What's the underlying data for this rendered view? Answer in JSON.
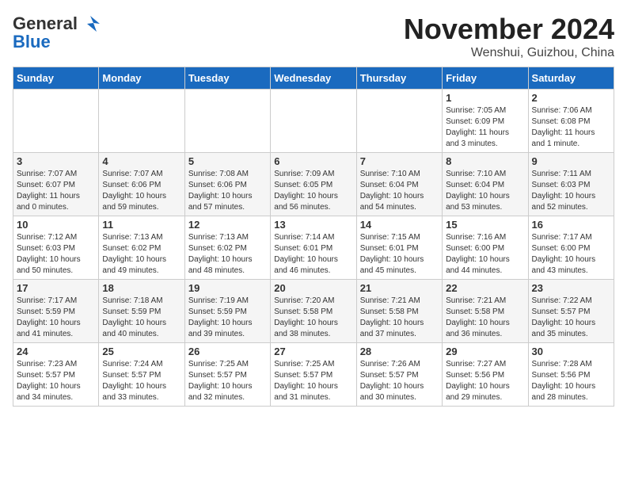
{
  "header": {
    "logo_line1": "General",
    "logo_line2": "Blue",
    "month_title": "November 2024",
    "location": "Wenshui, Guizhou, China"
  },
  "weekdays": [
    "Sunday",
    "Monday",
    "Tuesday",
    "Wednesday",
    "Thursday",
    "Friday",
    "Saturday"
  ],
  "weeks": [
    [
      {
        "day": "",
        "info": ""
      },
      {
        "day": "",
        "info": ""
      },
      {
        "day": "",
        "info": ""
      },
      {
        "day": "",
        "info": ""
      },
      {
        "day": "",
        "info": ""
      },
      {
        "day": "1",
        "info": "Sunrise: 7:05 AM\nSunset: 6:09 PM\nDaylight: 11 hours\nand 3 minutes."
      },
      {
        "day": "2",
        "info": "Sunrise: 7:06 AM\nSunset: 6:08 PM\nDaylight: 11 hours\nand 1 minute."
      }
    ],
    [
      {
        "day": "3",
        "info": "Sunrise: 7:07 AM\nSunset: 6:07 PM\nDaylight: 11 hours\nand 0 minutes."
      },
      {
        "day": "4",
        "info": "Sunrise: 7:07 AM\nSunset: 6:06 PM\nDaylight: 10 hours\nand 59 minutes."
      },
      {
        "day": "5",
        "info": "Sunrise: 7:08 AM\nSunset: 6:06 PM\nDaylight: 10 hours\nand 57 minutes."
      },
      {
        "day": "6",
        "info": "Sunrise: 7:09 AM\nSunset: 6:05 PM\nDaylight: 10 hours\nand 56 minutes."
      },
      {
        "day": "7",
        "info": "Sunrise: 7:10 AM\nSunset: 6:04 PM\nDaylight: 10 hours\nand 54 minutes."
      },
      {
        "day": "8",
        "info": "Sunrise: 7:10 AM\nSunset: 6:04 PM\nDaylight: 10 hours\nand 53 minutes."
      },
      {
        "day": "9",
        "info": "Sunrise: 7:11 AM\nSunset: 6:03 PM\nDaylight: 10 hours\nand 52 minutes."
      }
    ],
    [
      {
        "day": "10",
        "info": "Sunrise: 7:12 AM\nSunset: 6:03 PM\nDaylight: 10 hours\nand 50 minutes."
      },
      {
        "day": "11",
        "info": "Sunrise: 7:13 AM\nSunset: 6:02 PM\nDaylight: 10 hours\nand 49 minutes."
      },
      {
        "day": "12",
        "info": "Sunrise: 7:13 AM\nSunset: 6:02 PM\nDaylight: 10 hours\nand 48 minutes."
      },
      {
        "day": "13",
        "info": "Sunrise: 7:14 AM\nSunset: 6:01 PM\nDaylight: 10 hours\nand 46 minutes."
      },
      {
        "day": "14",
        "info": "Sunrise: 7:15 AM\nSunset: 6:01 PM\nDaylight: 10 hours\nand 45 minutes."
      },
      {
        "day": "15",
        "info": "Sunrise: 7:16 AM\nSunset: 6:00 PM\nDaylight: 10 hours\nand 44 minutes."
      },
      {
        "day": "16",
        "info": "Sunrise: 7:17 AM\nSunset: 6:00 PM\nDaylight: 10 hours\nand 43 minutes."
      }
    ],
    [
      {
        "day": "17",
        "info": "Sunrise: 7:17 AM\nSunset: 5:59 PM\nDaylight: 10 hours\nand 41 minutes."
      },
      {
        "day": "18",
        "info": "Sunrise: 7:18 AM\nSunset: 5:59 PM\nDaylight: 10 hours\nand 40 minutes."
      },
      {
        "day": "19",
        "info": "Sunrise: 7:19 AM\nSunset: 5:59 PM\nDaylight: 10 hours\nand 39 minutes."
      },
      {
        "day": "20",
        "info": "Sunrise: 7:20 AM\nSunset: 5:58 PM\nDaylight: 10 hours\nand 38 minutes."
      },
      {
        "day": "21",
        "info": "Sunrise: 7:21 AM\nSunset: 5:58 PM\nDaylight: 10 hours\nand 37 minutes."
      },
      {
        "day": "22",
        "info": "Sunrise: 7:21 AM\nSunset: 5:58 PM\nDaylight: 10 hours\nand 36 minutes."
      },
      {
        "day": "23",
        "info": "Sunrise: 7:22 AM\nSunset: 5:57 PM\nDaylight: 10 hours\nand 35 minutes."
      }
    ],
    [
      {
        "day": "24",
        "info": "Sunrise: 7:23 AM\nSunset: 5:57 PM\nDaylight: 10 hours\nand 34 minutes."
      },
      {
        "day": "25",
        "info": "Sunrise: 7:24 AM\nSunset: 5:57 PM\nDaylight: 10 hours\nand 33 minutes."
      },
      {
        "day": "26",
        "info": "Sunrise: 7:25 AM\nSunset: 5:57 PM\nDaylight: 10 hours\nand 32 minutes."
      },
      {
        "day": "27",
        "info": "Sunrise: 7:25 AM\nSunset: 5:57 PM\nDaylight: 10 hours\nand 31 minutes."
      },
      {
        "day": "28",
        "info": "Sunrise: 7:26 AM\nSunset: 5:57 PM\nDaylight: 10 hours\nand 30 minutes."
      },
      {
        "day": "29",
        "info": "Sunrise: 7:27 AM\nSunset: 5:56 PM\nDaylight: 10 hours\nand 29 minutes."
      },
      {
        "day": "30",
        "info": "Sunrise: 7:28 AM\nSunset: 5:56 PM\nDaylight: 10 hours\nand 28 minutes."
      }
    ]
  ]
}
